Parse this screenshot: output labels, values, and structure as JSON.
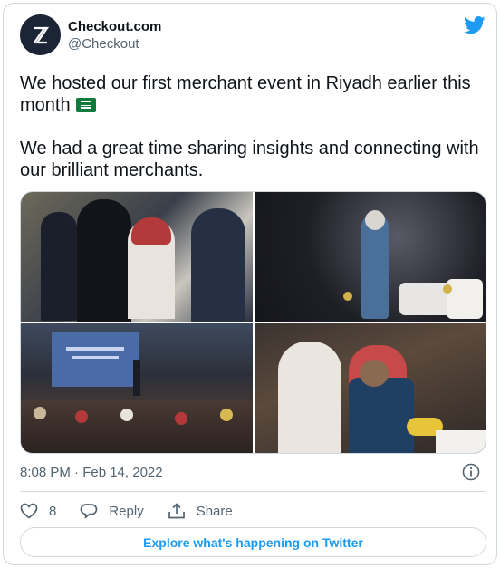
{
  "account": {
    "display_name": "Checkout.com",
    "handle": "@Checkout",
    "avatar_icon": "checkout-logo-icon"
  },
  "brand": {
    "logo_icon": "twitter-bird-icon",
    "accent": "#1d9bf0"
  },
  "tweet": {
    "line1": "We hosted our first merchant event in Riyadh earlier this month",
    "flag_icon": "saudi-arabia-flag-icon",
    "line2": "We had a great time sharing insights and connecting with our brilliant merchants.",
    "timestamp": "8:08 PM · Feb 14, 2022"
  },
  "media": {
    "photos": [
      {
        "icon": "event-attendees-photo"
      },
      {
        "icon": "speaker-on-stage-photo"
      },
      {
        "icon": "audience-presentation-photo"
      },
      {
        "icon": "panel-discussion-photo"
      }
    ]
  },
  "actions": {
    "like_count": "8",
    "reply_label": "Reply",
    "share_label": "Share"
  },
  "footer": {
    "explore_label": "Explore what's happening on Twitter"
  }
}
